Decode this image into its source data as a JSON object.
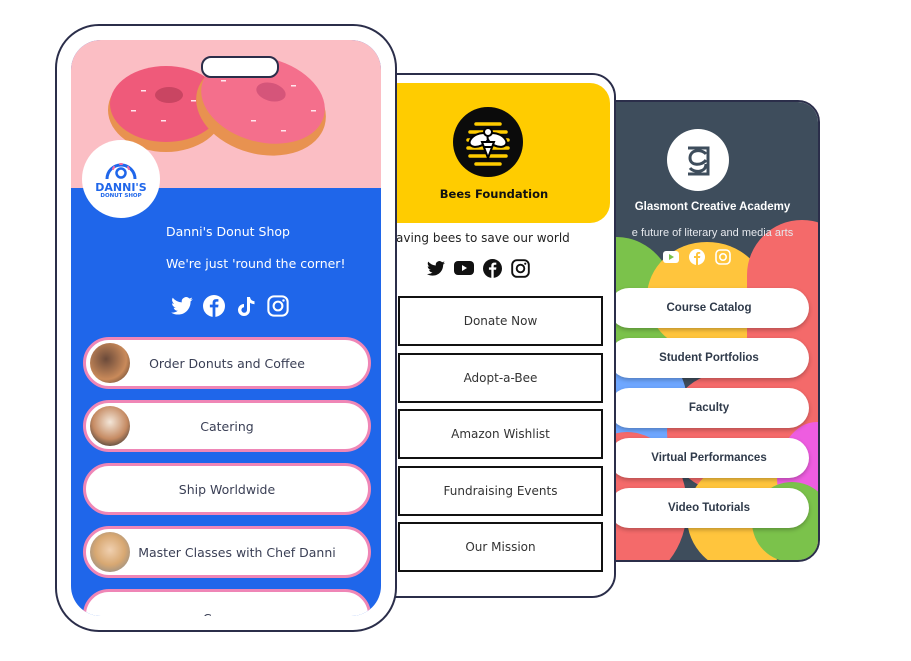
{
  "mockups": {
    "glasmont": {
      "title": "Glasmont Creative Academy",
      "tagline": "e future of literary and media arts",
      "social_icons": [
        "youtube-icon",
        "facebook-icon",
        "instagram-icon"
      ],
      "links": [
        "Course Catalog",
        "Student Portfolios",
        "Faculty",
        "Virtual Performances",
        "Video Tutorials"
      ],
      "colors": {
        "header_bg": "#3e4d5c",
        "button_text": "#2f3a4a"
      }
    },
    "bees": {
      "title": "Bees Foundation",
      "tagline": "aving bees to save our world",
      "social_icons": [
        "twitter-icon",
        "youtube-icon",
        "facebook-icon",
        "instagram-icon"
      ],
      "links": [
        "Donate Now",
        "Adopt-a-Bee",
        "Amazon Wishlist",
        "Fundraising Events",
        "Our Mission"
      ],
      "colors": {
        "hero_bg": "#ffcc00",
        "button_border": "#111111"
      }
    },
    "danni": {
      "logo_line1": "DANNI'S",
      "logo_line2": "DONUT SHOP",
      "title": "Danni's Donut Shop",
      "tagline": "We're just 'round the corner!",
      "social_icons": [
        "twitter-icon",
        "facebook-icon",
        "tiktok-icon",
        "instagram-icon"
      ],
      "links": [
        {
          "label": "Order Donuts and Coffee",
          "thumbnail": "donut-stack-photo"
        },
        {
          "label": "Catering",
          "thumbnail": "donut-tray-photo"
        },
        {
          "label": "Ship Worldwide",
          "thumbnail": null
        },
        {
          "label": "Master Classes with Chef Danni",
          "thumbnail": "chef-photo"
        },
        {
          "label": "Careers",
          "thumbnail": null
        }
      ],
      "colors": {
        "hero_bg": "#fbbec4",
        "page_bg": "#1f66ea",
        "button_border": "#ef86b6"
      }
    }
  }
}
